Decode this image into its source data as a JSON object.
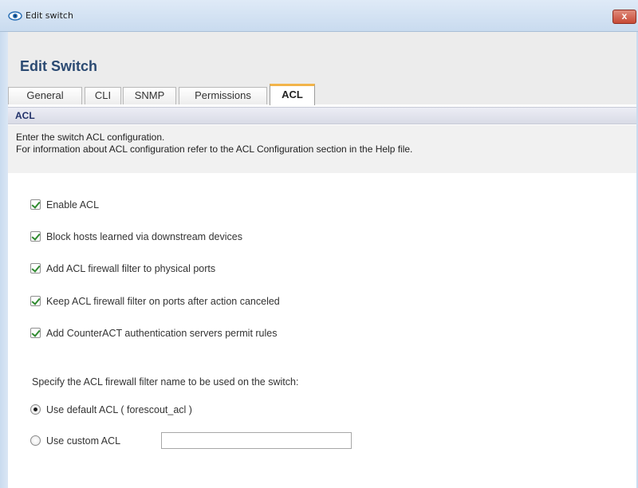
{
  "window": {
    "title": "Edit switch",
    "close_label": "x"
  },
  "page": {
    "title": "Edit Switch"
  },
  "tabs": [
    {
      "label": "General",
      "active": false
    },
    {
      "label": "CLI",
      "active": false
    },
    {
      "label": "SNMP",
      "active": false
    },
    {
      "label": "Permissions",
      "active": false
    },
    {
      "label": "ACL",
      "active": true
    }
  ],
  "section": {
    "header": "ACL",
    "description_line1": "Enter the switch ACL configuration.",
    "description_line2": "For information about ACL configuration refer to the ACL Configuration section in the Help file."
  },
  "options": [
    {
      "label": "Enable ACL",
      "checked": true
    },
    {
      "label": "Block hosts learned via downstream devices",
      "checked": true
    },
    {
      "label": "Add ACL firewall filter to physical ports",
      "checked": true
    },
    {
      "label": "Keep ACL firewall filter on ports after action canceled",
      "checked": true
    },
    {
      "label": "Add CounterACT authentication servers permit rules",
      "checked": true
    }
  ],
  "filter_name": {
    "instruction": "Specify the ACL firewall filter name to be used on the switch:",
    "default_option": {
      "label": "Use default ACL ( forescout_acl )",
      "selected": true
    },
    "custom_option": {
      "label": "Use custom ACL",
      "selected": false
    },
    "custom_value": ""
  },
  "colors": {
    "title": "#2b4a72",
    "active_tab_accent": "#f2b44a",
    "check_mark": "#2f8a2f",
    "section_header_text": "#23336b"
  }
}
